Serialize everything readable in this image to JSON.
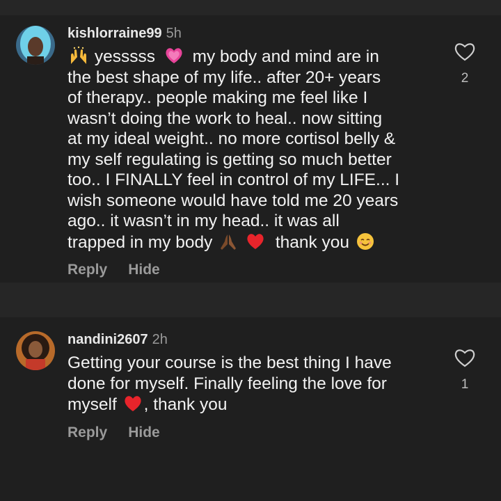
{
  "comments": [
    {
      "username": "kishlorraine99",
      "time": "5h",
      "text_lines": [
        [
          "",
          "yesssss",
          "my body and mind are in"
        ],
        "the best shape of my life.. after 20+ years",
        "of therapy.. people making me feel like I",
        "wasn’t doing the work to heal.. now sitting",
        "at my ideal weight.. no more cortisol belly &",
        "my self regulating is getting so much better",
        "too.. I FINALLY feel in control of my LIFE... I",
        "wish someone would have told me 20 years",
        "ago.. it wasn’t in my head.. it was all",
        [
          "trapped in my body",
          "thank you"
        ]
      ],
      "reply_label": "Reply",
      "hide_label": "Hide",
      "likes": "2",
      "emojis": [
        "raising-hands",
        "pink-heart",
        "folded-hands",
        "red-heart",
        "smiling-face"
      ]
    },
    {
      "username": "nandini2607",
      "time": "2h",
      "text_lines": [
        "Getting your course is the best thing I have",
        "done for myself.  Finally feeling the love for",
        [
          "myself",
          ", thank you"
        ]
      ],
      "reply_label": "Reply",
      "hide_label": "Hide",
      "likes": "1",
      "emojis": [
        "red-heart"
      ]
    }
  ],
  "colors": {
    "background": "#262626",
    "comment_background": "#1f1f1f",
    "text": "#f2f2f2",
    "muted": "#9a9a9a"
  }
}
